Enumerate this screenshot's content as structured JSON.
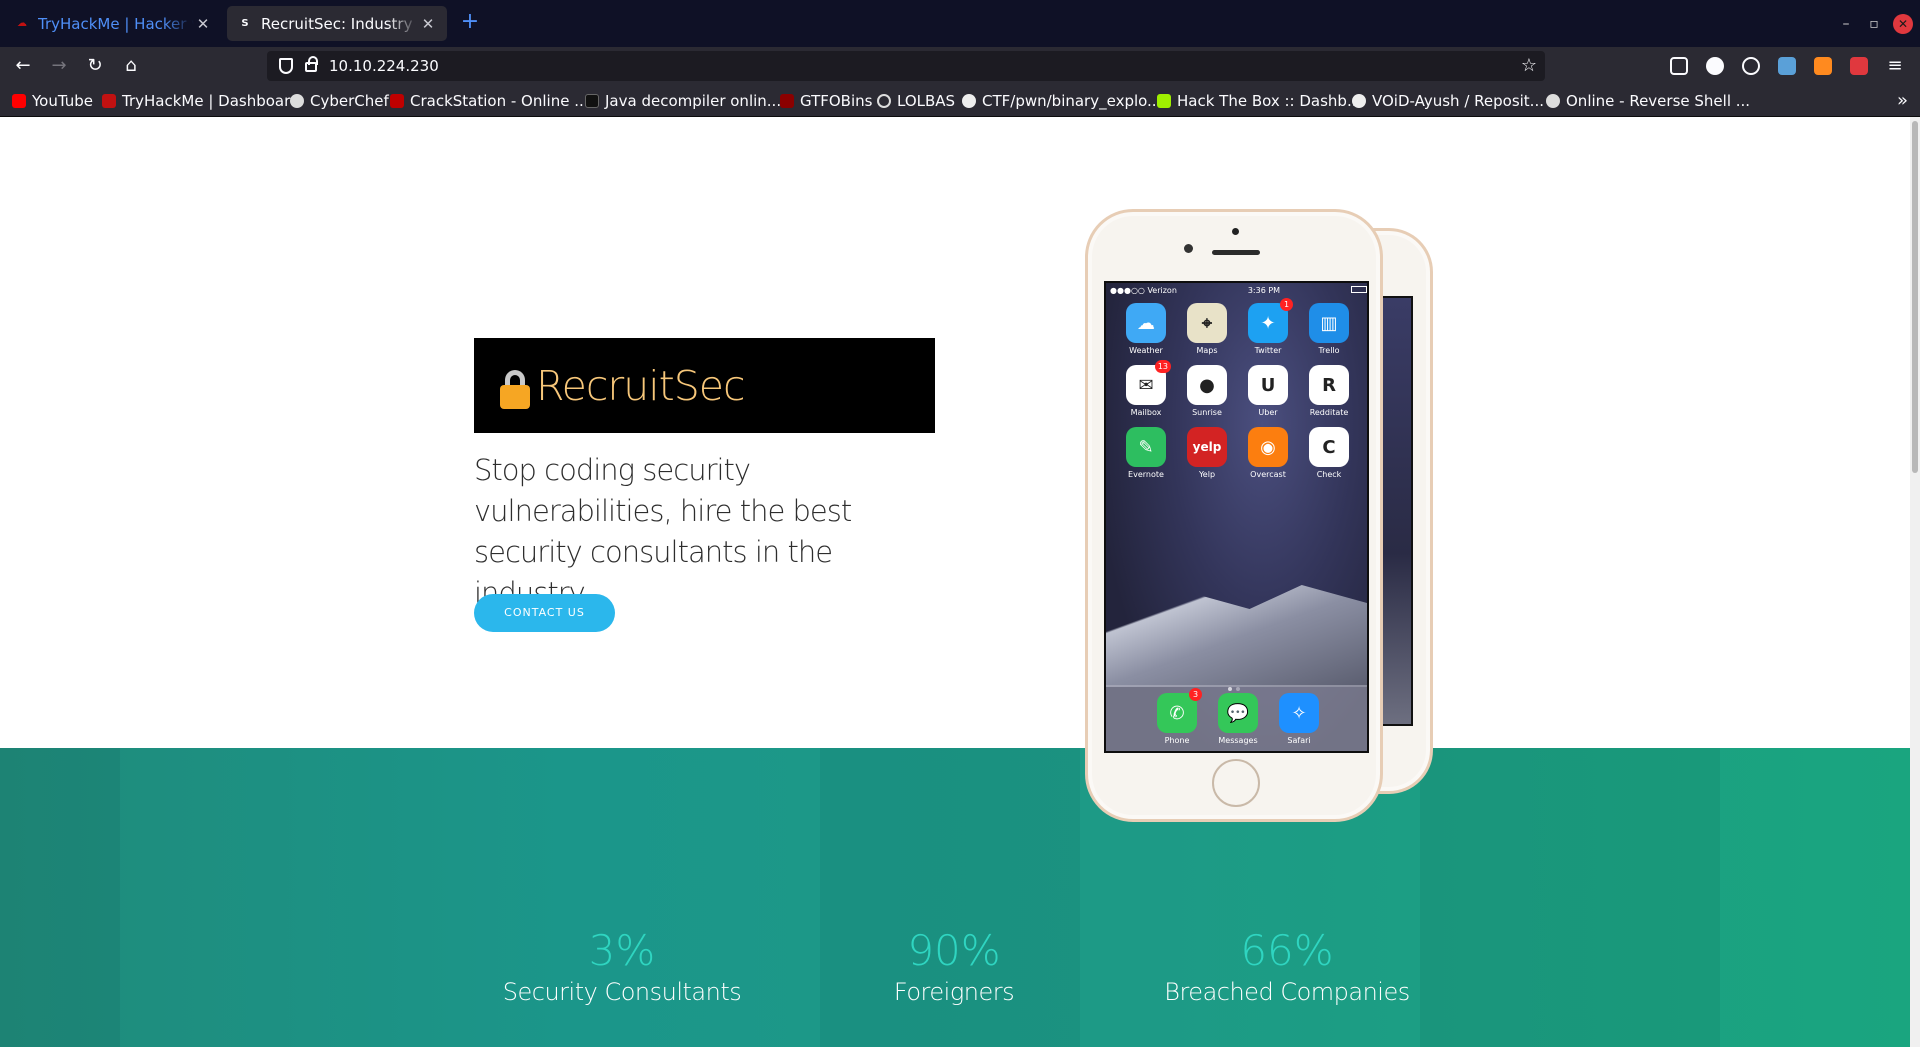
{
  "browser": {
    "tabs": [
      {
        "title": "TryHackMe | Hacker vs. Hacker",
        "active": false
      },
      {
        "title": "RecruitSec: Industry Leading",
        "active": true
      }
    ],
    "new_tab": "+",
    "url": "10.10.224.230",
    "bookmarks": [
      {
        "label": "YouTube",
        "color": "#ff0000"
      },
      {
        "label": "TryHackMe | Dashboard",
        "color": "#c11111"
      },
      {
        "label": "CyberChef",
        "color": "#dddddd"
      },
      {
        "label": "CrackStation - Online ...",
        "color": "#c00000"
      },
      {
        "label": "Java decompiler onlin...",
        "color": "#111111"
      },
      {
        "label": "GTFOBins",
        "color": "#8b0000"
      },
      {
        "label": "LOLBAS",
        "color": "#dddddd"
      },
      {
        "label": "CTF/pwn/binary_explo...",
        "color": "#eeeeee"
      },
      {
        "label": "Hack The Box :: Dashb...",
        "color": "#9fef00"
      },
      {
        "label": "VOiD-Ayush / Reposit...",
        "color": "#eeeeee"
      },
      {
        "label": "Online - Reverse Shell ...",
        "color": "#dddddd"
      }
    ]
  },
  "hero": {
    "brand": "RecruitSec",
    "tagline": "Stop coding security vulnerabilities, hire the best security consultants in the industry.",
    "cta": "CONTACT US"
  },
  "phone": {
    "carrier": "●●●○○ Verizon",
    "time": "3:36 PM",
    "apps": [
      {
        "label": "Weather",
        "icon": "weather-icon",
        "color": "#3fa9f5",
        "glyph": "☁",
        "badge": ""
      },
      {
        "label": "Maps",
        "icon": "maps-icon",
        "color": "#e8e2c8",
        "glyph": "⌖",
        "badge": ""
      },
      {
        "label": "Twitter",
        "icon": "twitter-icon",
        "color": "#1da1f2",
        "glyph": "✦",
        "badge": "1"
      },
      {
        "label": "Trello",
        "icon": "trello-icon",
        "color": "#1f8ee8",
        "glyph": "▥",
        "badge": ""
      },
      {
        "label": "Mailbox",
        "icon": "mailbox-icon",
        "color": "#ffffff",
        "glyph": "✉",
        "badge": "13"
      },
      {
        "label": "Sunrise",
        "icon": "sunrise-icon",
        "color": "#ffffff",
        "glyph": "●",
        "badge": ""
      },
      {
        "label": "Uber",
        "icon": "uber-icon",
        "color": "#ffffff",
        "glyph": "U",
        "badge": ""
      },
      {
        "label": "Redditate",
        "icon": "redditate-icon",
        "color": "#ffffff",
        "glyph": "R",
        "badge": ""
      },
      {
        "label": "Evernote",
        "icon": "evernote-icon",
        "color": "#2dbe60",
        "glyph": "✎",
        "badge": ""
      },
      {
        "label": "Yelp",
        "icon": "yelp-icon",
        "color": "#d32323",
        "glyph": "yelp",
        "badge": ""
      },
      {
        "label": "Overcast",
        "icon": "overcast-icon",
        "color": "#fc7e0f",
        "glyph": "◉",
        "badge": ""
      },
      {
        "label": "Check",
        "icon": "check-icon",
        "color": "#ffffff",
        "glyph": "C",
        "badge": ""
      }
    ],
    "dock": [
      {
        "label": "Phone",
        "icon": "phone-icon",
        "color": "#34c759",
        "glyph": "✆",
        "badge": "3"
      },
      {
        "label": "Messages",
        "icon": "messages-icon",
        "color": "#34c759",
        "glyph": "💬",
        "badge": ""
      },
      {
        "label": "Safari",
        "icon": "safari-icon",
        "color": "#1e90ff",
        "glyph": "✧",
        "badge": ""
      }
    ]
  },
  "stats": [
    {
      "value": "3%",
      "label": "Security Consultants"
    },
    {
      "value": "90%",
      "label": "Foreigners"
    },
    {
      "value": "66%",
      "label": "Breached Companies"
    }
  ],
  "colors": {
    "accent": "#2bb7ec",
    "band": "#1b968a",
    "stat_number": "#2fd5c1"
  }
}
